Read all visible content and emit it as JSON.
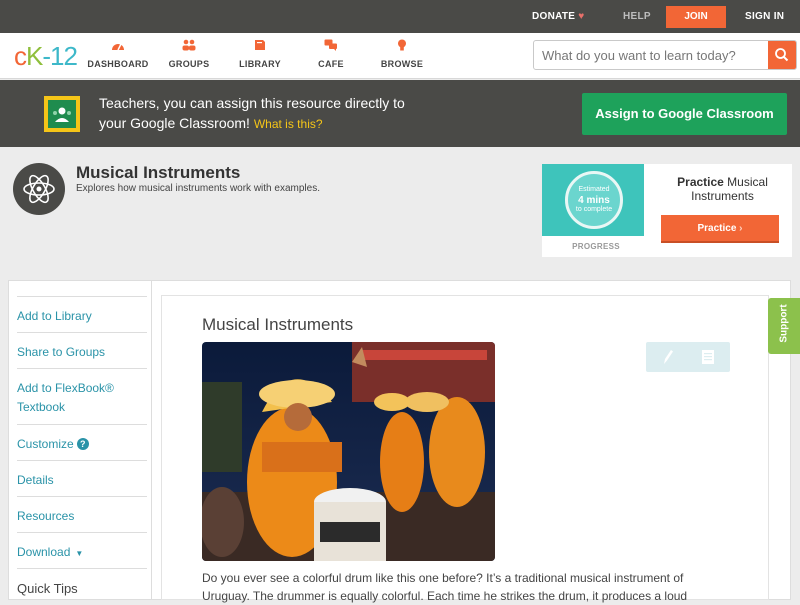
{
  "topbar": {
    "donate": "DONATE",
    "help": "HELP",
    "join": "JOIN",
    "signin": "SIGN IN"
  },
  "logo": {
    "c": "c",
    "k": "K",
    "n": "-12"
  },
  "nav": {
    "items": [
      {
        "label": "DASHBOARD",
        "icon": "gauge-icon"
      },
      {
        "label": "GROUPS",
        "icon": "people-icon"
      },
      {
        "label": "LIBRARY",
        "icon": "book-icon"
      },
      {
        "label": "CAFE",
        "icon": "chat-icon"
      },
      {
        "label": "BROWSE",
        "icon": "bulb-icon"
      }
    ],
    "search_placeholder": "What do you want to learn today?"
  },
  "banner": {
    "line1": "Teachers, you can assign this resource directly to",
    "line2": "your Google Classroom!",
    "what": "What is this?",
    "assign": "Assign to Google Classroom"
  },
  "page": {
    "title": "Musical Instruments",
    "subtitle": "Explores how musical instruments work with examples."
  },
  "practice": {
    "ring_line1": "Estimated",
    "ring_line2": "4 mins",
    "ring_line3": "to complete",
    "progress": "PROGRESS",
    "title_bold": "Practice",
    "title_rest": " Musical Instruments",
    "button": "Practice"
  },
  "sidebar": {
    "items": [
      "Add to Library",
      "Share to Groups",
      "Add to FlexBook® Textbook",
      "Customize",
      "Details",
      "Resources",
      "Download",
      "Quick Tips"
    ]
  },
  "content": {
    "title": "Musical Instruments",
    "paragraph": "Do you ever see a colorful drum like this one before? It’s a traditional musical instrument of Uruguay. The drummer is equally colorful. Each time he strikes the drum, it produces a loud"
  },
  "support": "Support",
  "colors": {
    "accent": "#f26636",
    "green": "#1ea25b",
    "link": "#2a93a8",
    "teal": "#3ec4bb"
  }
}
